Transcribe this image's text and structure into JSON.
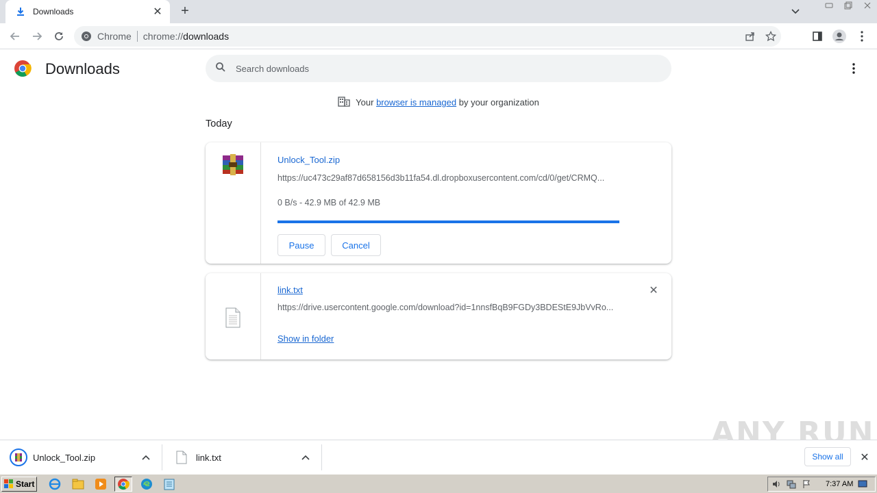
{
  "tab": {
    "title": "Downloads",
    "favicon": "download-icon"
  },
  "window": {
    "minimize": "minimize-icon",
    "restore": "restore-icon",
    "close": "close-icon"
  },
  "toolbar": {
    "site_label": "Chrome",
    "url_scheme": "chrome://",
    "url_path": "downloads"
  },
  "page": {
    "title": "Downloads",
    "search_placeholder": "Search downloads",
    "managed_prefix": "Your",
    "managed_link": "browser is managed",
    "managed_suffix": "by your organization",
    "section": "Today"
  },
  "downloads": [
    {
      "name": "Unlock_Tool.zip",
      "url": "https://uc473c29af87d658156d3b11fa54.dl.dropboxusercontent.com/cd/0/get/CRMQ...",
      "status": "0 B/s - 42.9 MB of 42.9 MB",
      "progress": 1.0,
      "pause_label": "Pause",
      "cancel_label": "Cancel",
      "icon": "winrar-archive-icon"
    },
    {
      "name": "link.txt",
      "url": "https://drive.usercontent.google.com/download?id=1nnsfBqB9FGDy3BDEStE9JbVvRo...",
      "show_folder_label": "Show in folder",
      "icon": "text-file-icon"
    }
  ],
  "shelf": {
    "items": [
      {
        "name": "Unlock_Tool.zip"
      },
      {
        "name": "link.txt"
      }
    ],
    "show_all_label": "Show all",
    "watermark": "ANY RUN"
  },
  "taskbar": {
    "start_label": "Start",
    "clock": "7:37 AM"
  },
  "colors": {
    "accent": "#1a73e8",
    "link": "#1967d2",
    "progress": "#1a73e8"
  }
}
